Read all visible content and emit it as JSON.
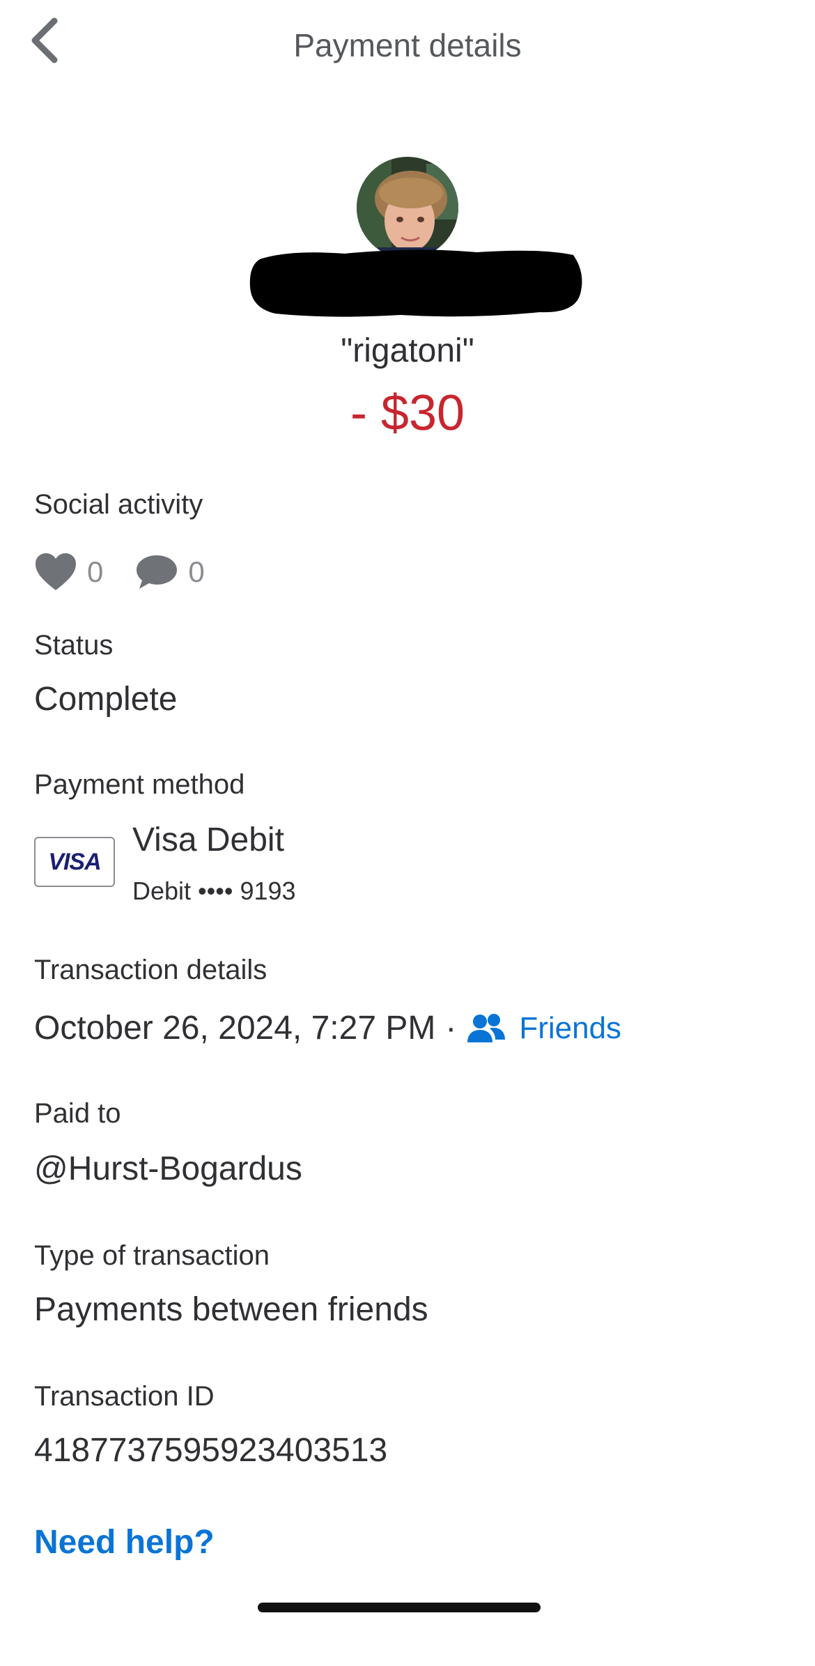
{
  "header": {
    "title": "Payment details",
    "back_icon": "chevron-left-icon"
  },
  "payment": {
    "note": "\"rigatoni\"",
    "amount": "- $30",
    "amount_color": "#c8262f"
  },
  "social": {
    "label": "Social activity",
    "likes_count": "0",
    "comments_count": "0",
    "like_icon": "heart-icon",
    "comment_icon": "comment-icon"
  },
  "status": {
    "label": "Status",
    "value": "Complete"
  },
  "payment_method": {
    "label": "Payment method",
    "card_brand": "VISA",
    "name": "Visa Debit",
    "detail": "Debit •••• 9193"
  },
  "transaction": {
    "label": "Transaction details",
    "datetime": "October 26, 2024, 7:27 PM",
    "separator": "·",
    "audience": "Friends",
    "audience_icon": "friends-icon"
  },
  "paid_to": {
    "label": "Paid to",
    "value": "@Hurst-Bogardus"
  },
  "type": {
    "label": "Type of transaction",
    "value": "Payments between friends"
  },
  "transaction_id": {
    "label": "Transaction ID",
    "value": "4187737595923403513"
  },
  "help": {
    "label": "Need help?"
  },
  "colors": {
    "accent": "#0a74d6",
    "text": "#2f3033",
    "muted": "#8a8d91"
  }
}
